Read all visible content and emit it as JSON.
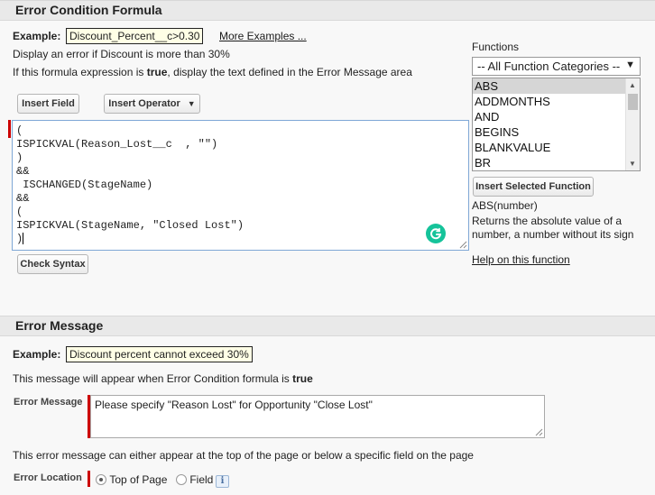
{
  "condition_section": {
    "title": "Error Condition Formula",
    "example_label": "Example:",
    "example_value": "Discount_Percent__c>0.30",
    "more_examples": "More Examples ...",
    "description": "Display an error if Discount is more than 30%",
    "instruction_prefix": "If this formula expression is ",
    "instruction_bold": "true",
    "instruction_suffix": ", display the text defined in the Error Message area",
    "insert_field_label": "Insert Field",
    "insert_operator_label": "Insert Operator",
    "formula_lines": [
      "(",
      "ISPICKVAL(Reason_Lost__c  , \"\")",
      ")",
      "&&",
      " ISCHANGED(StageName)",
      "&&",
      "(",
      "ISPICKVAL(StageName, \"Closed Lost\")",
      ")"
    ],
    "check_syntax_label": "Check Syntax"
  },
  "functions_panel": {
    "label": "Functions",
    "category_selected": "-- All Function Categories --",
    "items": [
      "ABS",
      "ADDMONTHS",
      "AND",
      "BEGINS",
      "BLANKVALUE",
      "BR"
    ],
    "selected_item": "ABS",
    "insert_selected_label": "Insert Selected Function",
    "signature": "ABS(number)",
    "description": "Returns the absolute value of a number, a number without its sign",
    "help_link": "Help on this function"
  },
  "message_section": {
    "title": "Error Message",
    "example_label": "Example:",
    "example_value": "Discount percent cannot exceed 30%",
    "note_prefix": "This message will appear when Error Condition formula is ",
    "note_bold": "true",
    "error_message_label": "Error Message",
    "error_message_value": "Please specify \"Reason Lost\" for Opportunity \"Close Lost\"",
    "location_note": "This error message can either appear at the top of the page or below a specific field on the page",
    "error_location_label": "Error Location",
    "location_options": [
      "Top of Page",
      "Field"
    ],
    "location_selected": "Top of Page"
  },
  "colors": {
    "required_bar": "#cc0000",
    "grammarly": "#15c39a",
    "editor_border": "#7fa7d6"
  }
}
